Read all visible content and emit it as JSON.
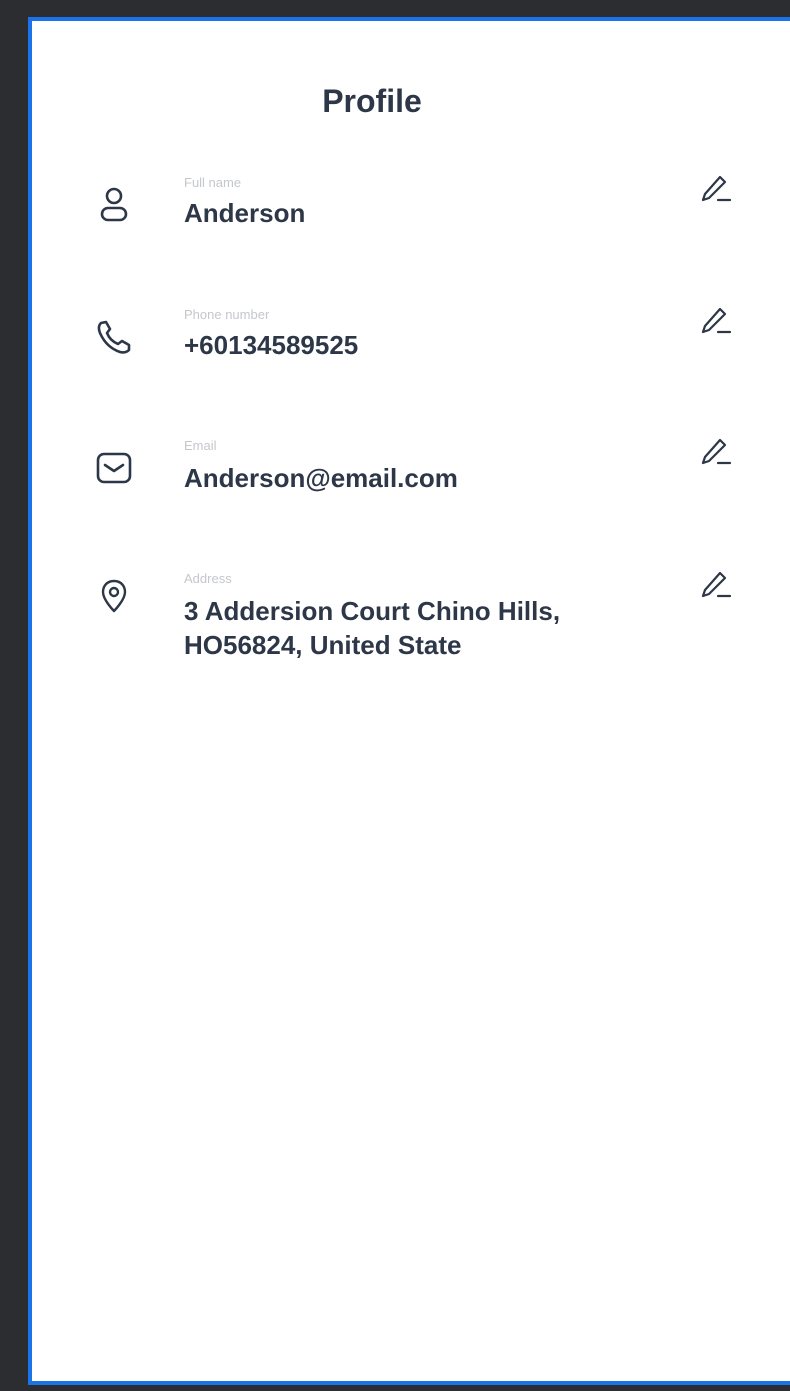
{
  "header": {
    "title": "Profile"
  },
  "fields": [
    {
      "label": "Full name",
      "value": "Anderson",
      "icon": "person-icon"
    },
    {
      "label": "Phone number",
      "value": "+60134589525",
      "icon": "phone-icon"
    },
    {
      "label": "Email",
      "value": "Anderson@email.com",
      "icon": "mail-icon"
    },
    {
      "label": "Address",
      "value": "3 Addersion Court Chino Hills, HO56824, United State",
      "icon": "location-pin-icon"
    }
  ],
  "colors": {
    "text": "#2d3748",
    "label": "#c4c7cc",
    "frame_border": "#1a73e8",
    "outer_background": "#2b2d31"
  }
}
